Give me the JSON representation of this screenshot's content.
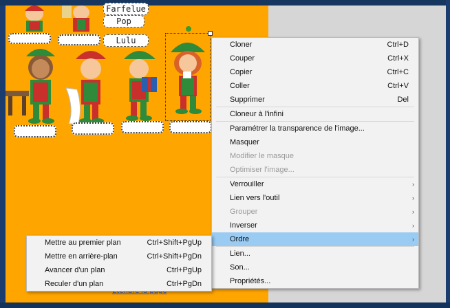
{
  "canvas": {
    "top_labels": [
      "Farfelue",
      "Pop",
      "Lulu"
    ],
    "footer_link": "Étendre la page"
  },
  "context_menu": {
    "group1": [
      {
        "label": "Cloner",
        "shortcut": "Ctrl+D"
      },
      {
        "label": "Couper",
        "shortcut": "Ctrl+X"
      },
      {
        "label": "Copier",
        "shortcut": "Ctrl+C"
      },
      {
        "label": "Coller",
        "shortcut": "Ctrl+V"
      },
      {
        "label": "Supprimer",
        "shortcut": "Del"
      }
    ],
    "group2": [
      {
        "label": "Cloneur à l'infini"
      }
    ],
    "group3": [
      {
        "label": "Paramétrer la transparence de l'image..."
      },
      {
        "label": "Masquer"
      },
      {
        "label": "Modifier le masque",
        "disabled": true
      },
      {
        "label": "Optimiser l'image...",
        "disabled": true
      }
    ],
    "group4": [
      {
        "label": "Verrouiller"
      },
      {
        "label": "Lien vers l'outil"
      },
      {
        "label": "Grouper",
        "disabled": true
      },
      {
        "label": "Inverser"
      },
      {
        "label": "Ordre",
        "highlighted": true
      }
    ],
    "group5": [
      {
        "label": "Lien..."
      },
      {
        "label": "Son..."
      },
      {
        "label": "Propriétés..."
      }
    ],
    "submenu_arrow": "›"
  },
  "order_submenu": {
    "items": [
      {
        "label": "Mettre au premier plan",
        "shortcut": "Ctrl+Shift+PgUp"
      },
      {
        "label": "Mettre en arrière-plan",
        "shortcut": "Ctrl+Shift+PgDn"
      },
      {
        "label": "Avancer d'un plan",
        "shortcut": "Ctrl+PgUp"
      },
      {
        "label": "Reculer d'un plan",
        "shortcut": "Ctrl+PgDn"
      }
    ]
  },
  "colors": {
    "canvas_bg": "#ffa500",
    "menu_bg": "#f2f2f2",
    "highlight": "#99cbf3",
    "frame_blue": "#1a3c6e"
  }
}
